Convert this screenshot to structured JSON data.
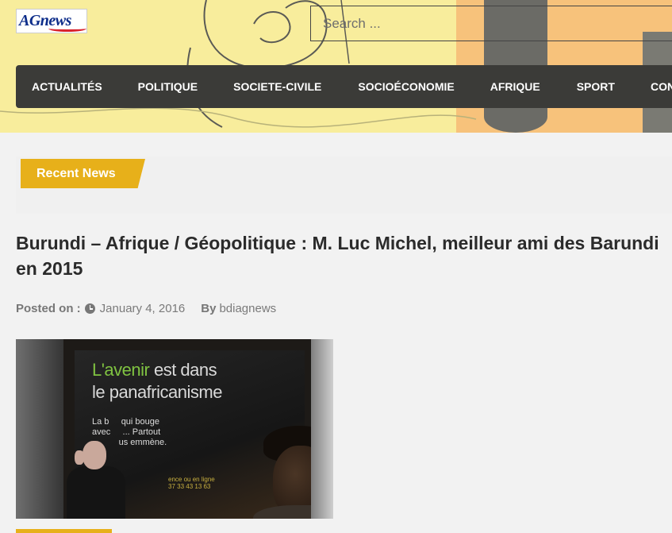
{
  "header": {
    "logo_text": "AGnews",
    "search": {
      "placeholder": "Search ...",
      "value": ""
    }
  },
  "nav": {
    "items": [
      {
        "label": "ACTUALITÉS"
      },
      {
        "label": "POLITIQUE"
      },
      {
        "label": "SOCIETE-CIVILE"
      },
      {
        "label": "SOCIOÉCONOMIE"
      },
      {
        "label": "AFRIQUE"
      },
      {
        "label": "SPORT"
      },
      {
        "label": "CON"
      }
    ]
  },
  "recent_news": {
    "label": "Recent News"
  },
  "post": {
    "title": "Burundi – Afrique / Géopolitique : M. Luc Michel, meilleur ami des Barundi en 2015",
    "meta": {
      "posted_on_label": "Posted on :",
      "date": "January 4, 2016",
      "by_label": "By",
      "author": "bdiagnews"
    },
    "image": {
      "poster_line1_a": "L'avenir",
      "poster_line1_b": " est dans",
      "poster_line2": "le panafricanisme",
      "poster_small": "La b     qui bouge\navec     ... Partout\n           us emmène.",
      "poster_contact": "ence ou en ligne\n37 33 43 13 63"
    }
  },
  "colors": {
    "accent": "#e7b01a",
    "nav_bg": "#3b3b38",
    "header_yellow": "#f8ed9c",
    "header_orange": "#f7c27b",
    "title_text": "#2b2b2b"
  },
  "icons": {
    "date": "clock-icon"
  }
}
